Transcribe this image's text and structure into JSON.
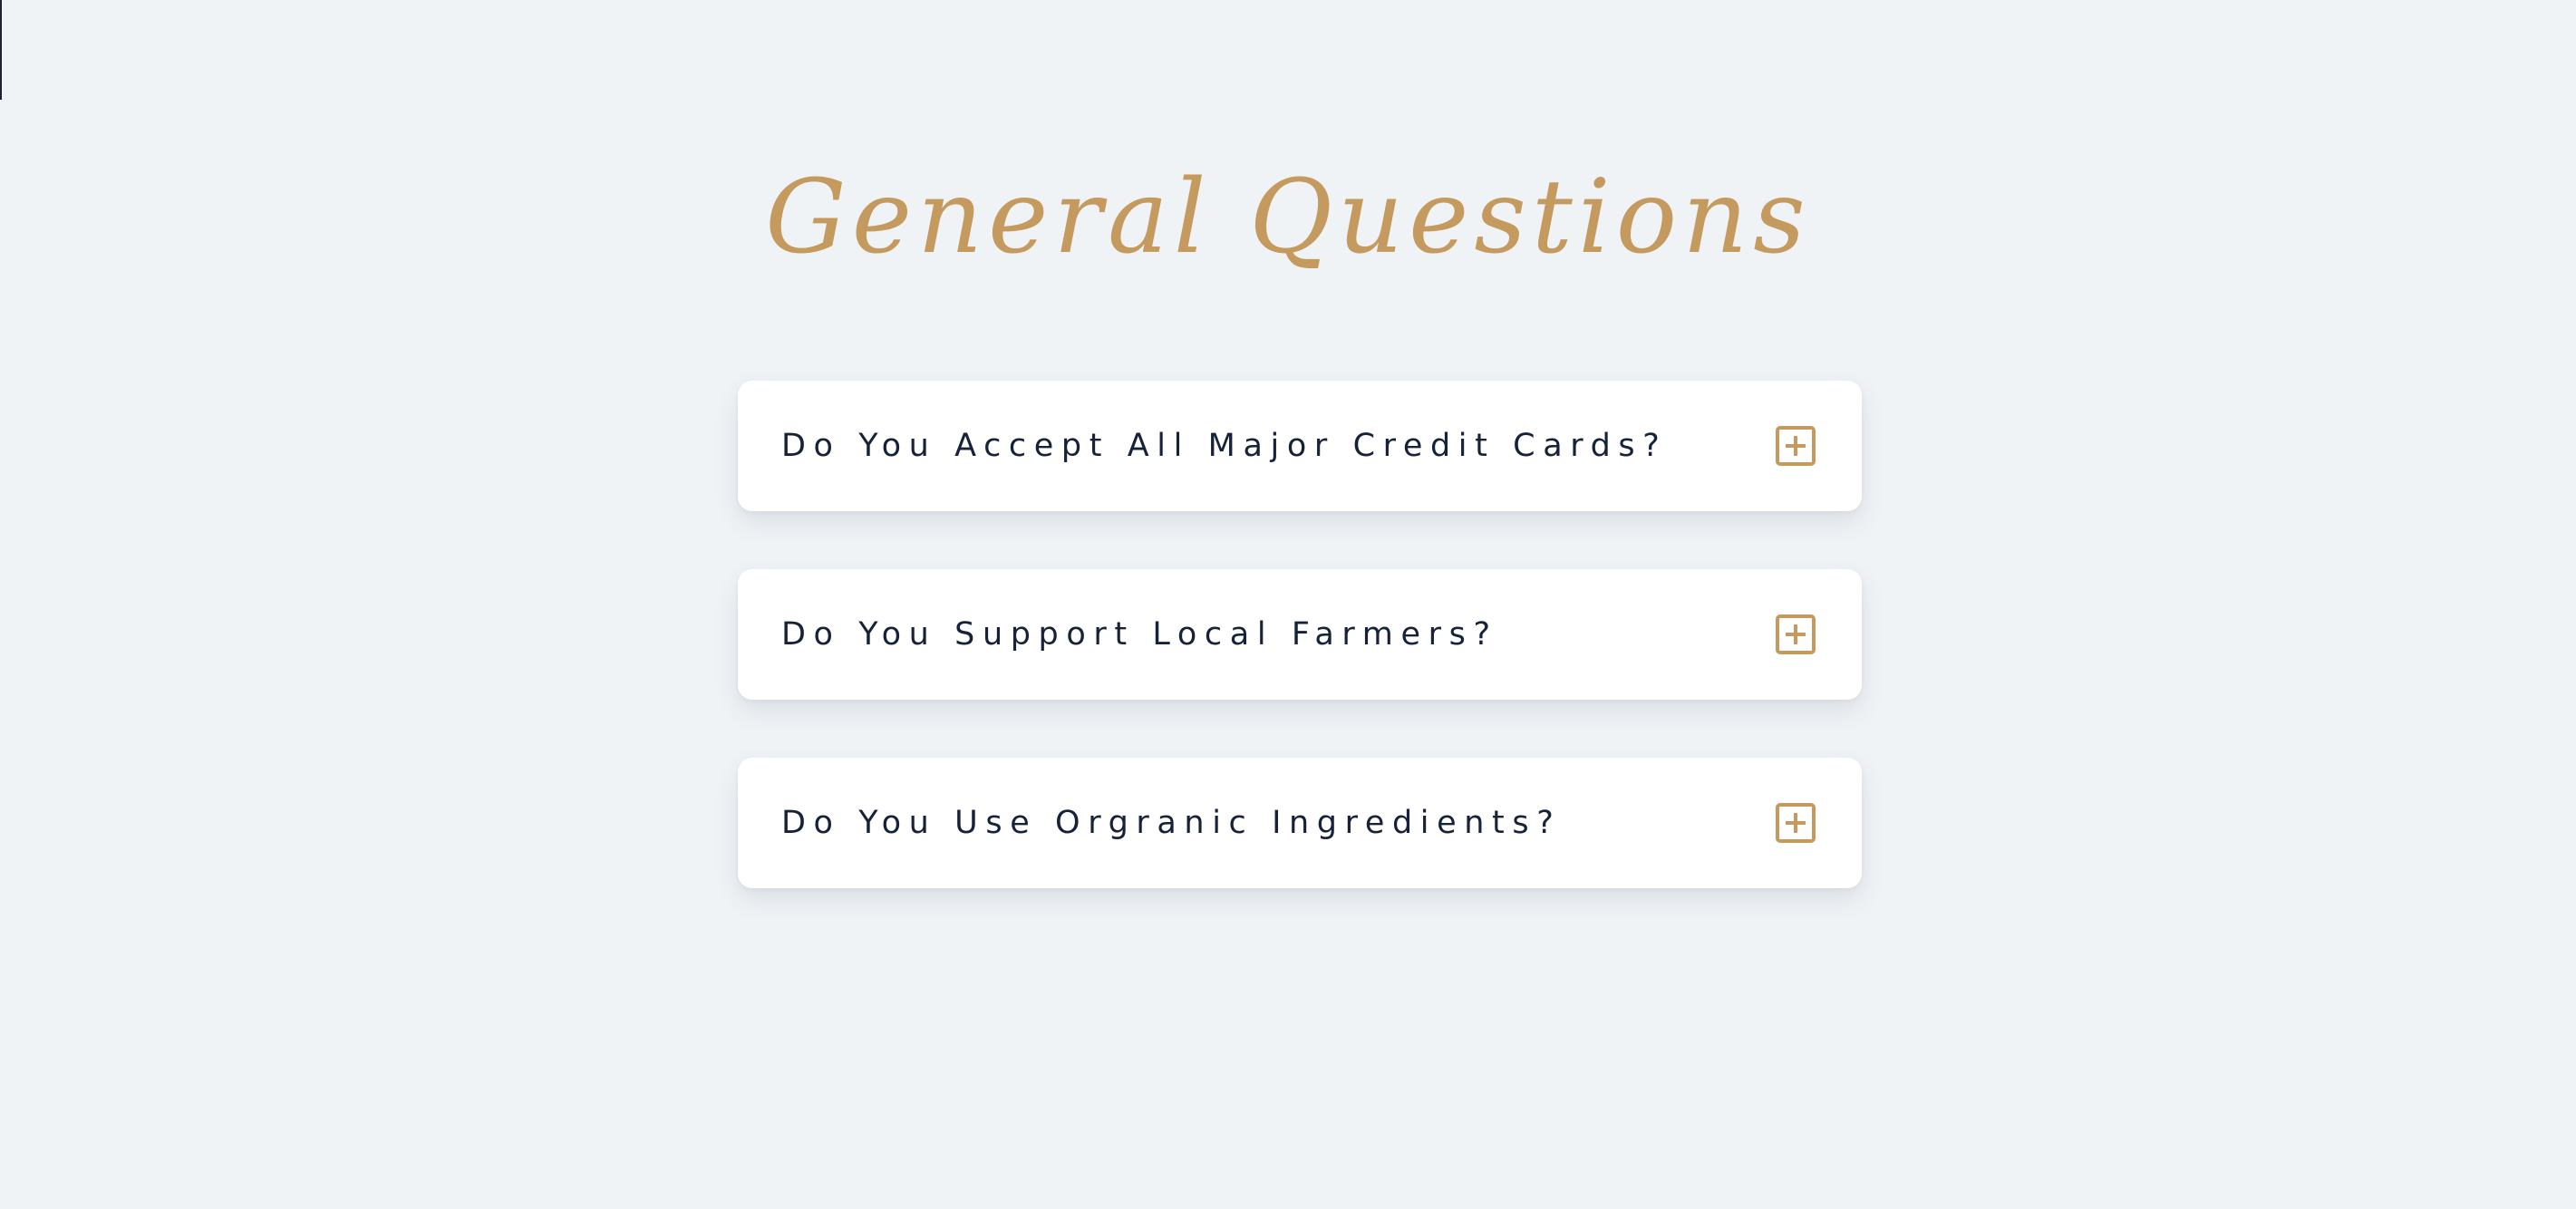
{
  "page": {
    "title": "General Questions"
  },
  "faq": {
    "items": [
      {
        "question": "Do You Accept All Major Credit Cards?",
        "icon": "plus-square-icon"
      },
      {
        "question": "Do You Support Local Farmers?",
        "icon": "plus-square-icon"
      },
      {
        "question": "Do You Use Orgranic Ingredients?",
        "icon": "plus-square-icon"
      }
    ]
  },
  "colors": {
    "background": "#f0f3f6",
    "accent": "#c49a5e",
    "text": "#152238",
    "card": "#ffffff"
  }
}
